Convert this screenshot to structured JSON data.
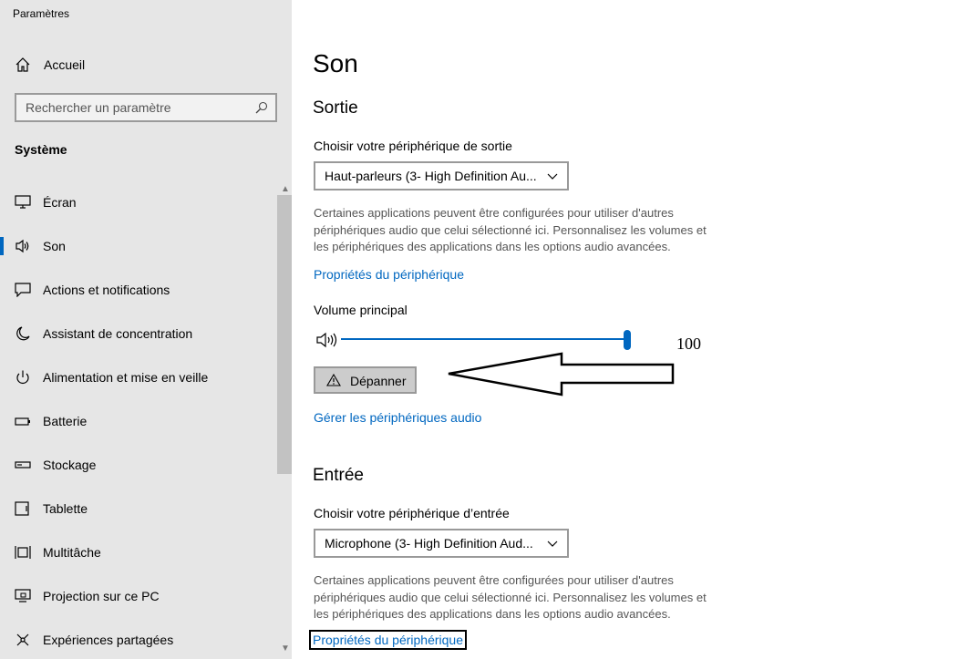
{
  "app": {
    "title": "Paramètres"
  },
  "sidebar": {
    "home_label": "Accueil",
    "search_placeholder": "Rechercher un paramètre",
    "section_title": "Système",
    "items": [
      {
        "label": "Écran",
        "icon": "monitor-icon",
        "active": false
      },
      {
        "label": "Son",
        "icon": "speaker-icon",
        "active": true
      },
      {
        "label": "Actions et notifications",
        "icon": "notification-icon",
        "active": false
      },
      {
        "label": "Assistant de concentration",
        "icon": "moon-icon",
        "active": false
      },
      {
        "label": "Alimentation et mise en veille",
        "icon": "power-icon",
        "active": false
      },
      {
        "label": "Batterie",
        "icon": "battery-icon",
        "active": false
      },
      {
        "label": "Stockage",
        "icon": "storage-icon",
        "active": false
      },
      {
        "label": "Tablette",
        "icon": "tablet-icon",
        "active": false
      },
      {
        "label": "Multitâche",
        "icon": "multitask-icon",
        "active": false
      },
      {
        "label": "Projection sur ce PC",
        "icon": "projection-icon",
        "active": false
      },
      {
        "label": "Expériences partagées",
        "icon": "shared-icon",
        "active": false
      }
    ]
  },
  "main": {
    "title": "Son",
    "output": {
      "heading": "Sortie",
      "device_label": "Choisir votre périphérique de sortie",
      "device_value": "Haut-parleurs (3- High Definition Au...",
      "description": "Certaines applications peuvent être configurées pour utiliser d'autres périphériques audio que celui sélectionné ici. Personnalisez les volumes et les périphériques des applications dans les options audio avancées.",
      "properties_link": "Propriétés du périphérique",
      "volume_label": "Volume principal",
      "volume_value": "100",
      "volume_level": 100,
      "troubleshoot_label": "Dépanner",
      "manage_link": "Gérer les périphériques audio"
    },
    "input": {
      "heading": "Entrée",
      "device_label": "Choisir votre périphérique d’entrée",
      "device_value": "Microphone (3- High Definition Aud...",
      "description": "Certaines applications peuvent être configurées pour utiliser d'autres périphériques audio que celui sélectionné ici. Personnalisez les volumes et les périphériques des applications dans les options audio avancées.",
      "properties_link": "Propriétés du périphérique"
    }
  },
  "colors": {
    "accent": "#0067c0",
    "sidebar_bg": "#e6e6e6"
  }
}
